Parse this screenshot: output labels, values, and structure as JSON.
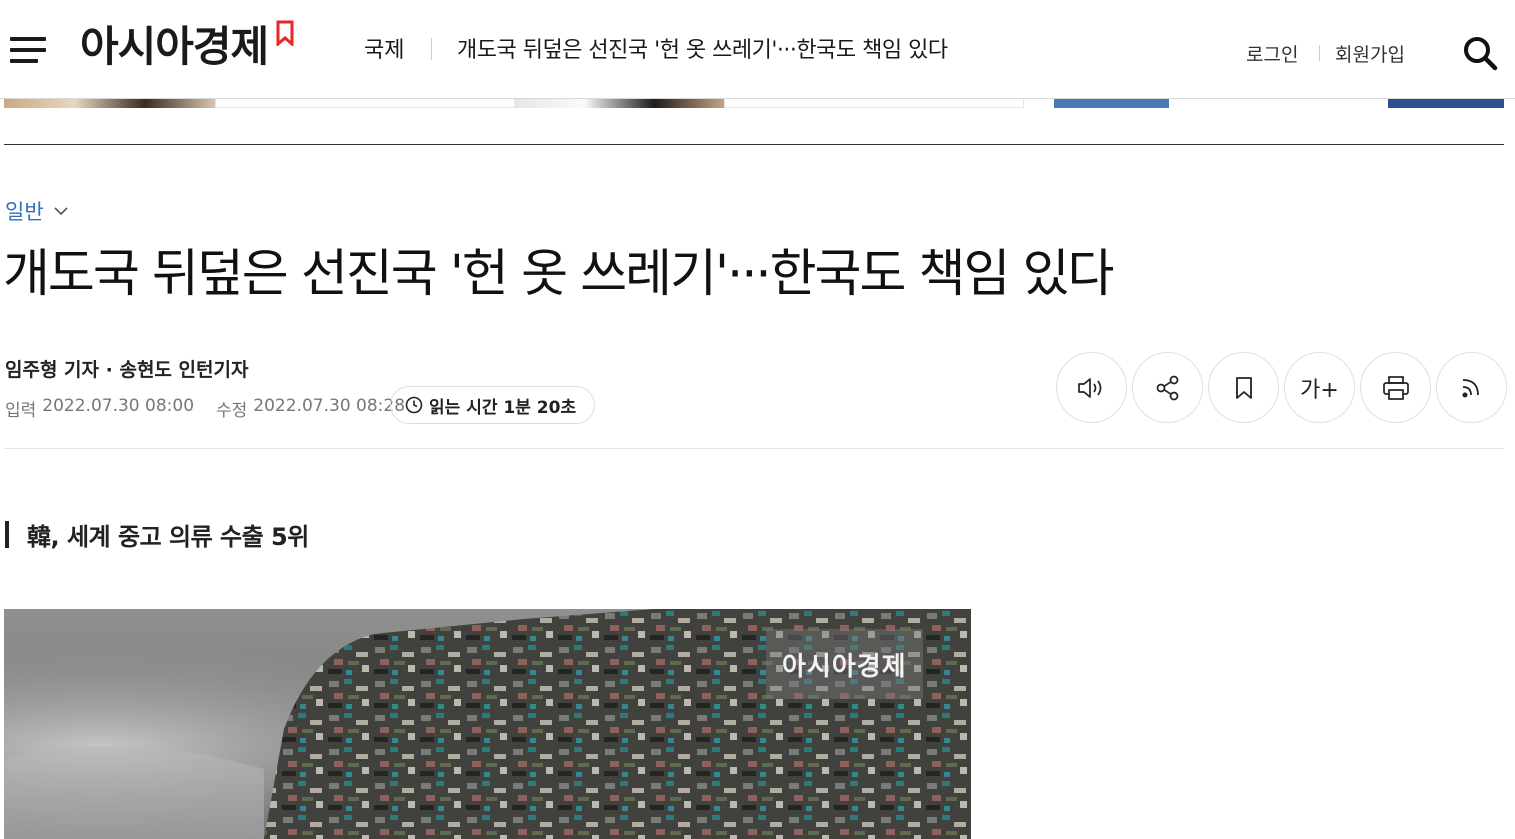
{
  "header": {
    "logo_text": "아시아경제",
    "section": "국제",
    "headline": "개도국 뒤덮은 선진국 '헌 옷 쓰레기'···한국도 책임 있다",
    "login": "로그인",
    "signup": "회원가입"
  },
  "article": {
    "category": "일반",
    "title": "개도국 뒤덮은 선진국 '헌 옷 쓰레기'···한국도 책임 있다",
    "byline": "임주형 기자 · 송현도 인턴기자",
    "input_label": "입력",
    "input_date": "2022.07.30 08:00",
    "modified_label": "수정",
    "modified_date": "2022.07.30 08:28",
    "read_time": "읽는 시간  1분 20초",
    "subheading": "韓, 세계 중고 의류 수출 5위"
  },
  "tools": {
    "font_size_label": "가+"
  },
  "image": {
    "watermark": "아시아경제"
  },
  "colors": {
    "brand_red": "#e8262b",
    "category_blue": "#2f6fc1"
  },
  "icons": [
    "menu-icon",
    "search-icon",
    "chevron-down-icon",
    "clock-icon",
    "speaker-icon",
    "share-icon",
    "bookmark-icon",
    "print-icon",
    "rss-icon"
  ]
}
